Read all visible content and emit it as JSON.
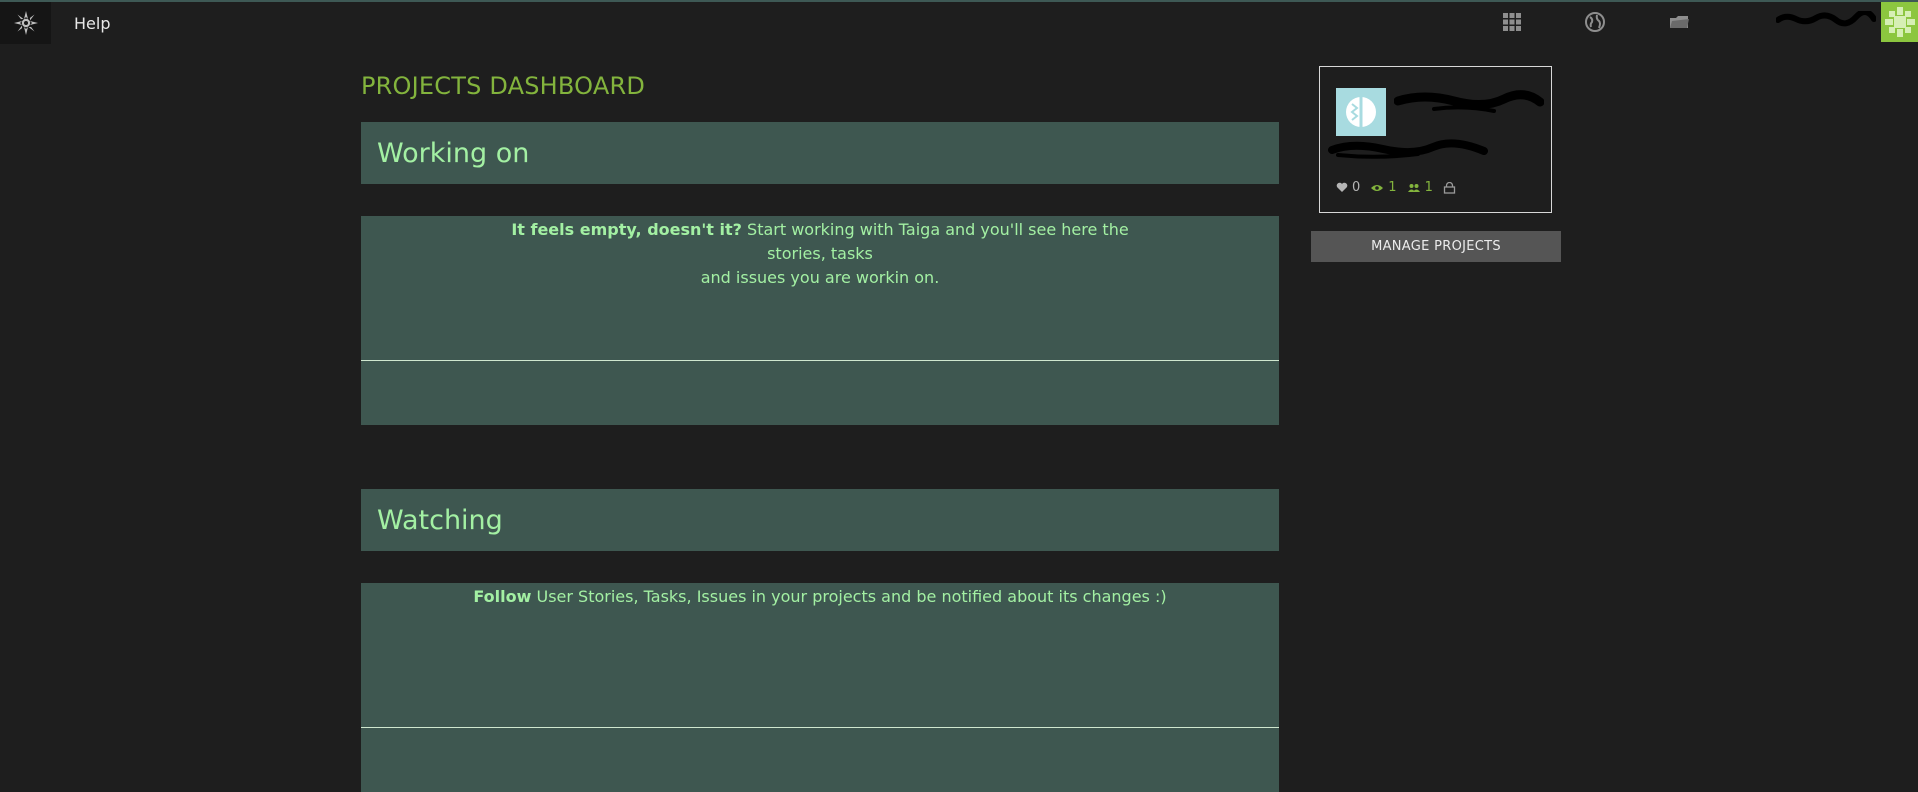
{
  "nav": {
    "help_label": "Help",
    "icons": [
      "taiga-logo-icon",
      "grid-icon",
      "globe-icon",
      "folder-icon",
      "user-avatar-icon"
    ]
  },
  "page": {
    "title": "PROJECTS DASHBOARD"
  },
  "working_on": {
    "title": "Working on",
    "empty_bold": "It feels empty, doesn't it?",
    "empty_text_line1": "Start working with Taiga and you'll see here the stories, tasks",
    "empty_text_line2": "and issues you are workin on."
  },
  "watching": {
    "title": "Watching",
    "empty_bold": "Follow",
    "empty_text": "User Stories, Tasks, Issues in your projects and be notified about its changes :)"
  },
  "project_card": {
    "fans": "0",
    "watchers": "1",
    "members": "1"
  },
  "sidebar": {
    "manage_label": "MANAGE PROJECTS"
  },
  "colors": {
    "accent_green": "#83b43d",
    "panel": "#3e5750",
    "panel_text": "#a3f0a3",
    "background": "#1e1e1e"
  }
}
